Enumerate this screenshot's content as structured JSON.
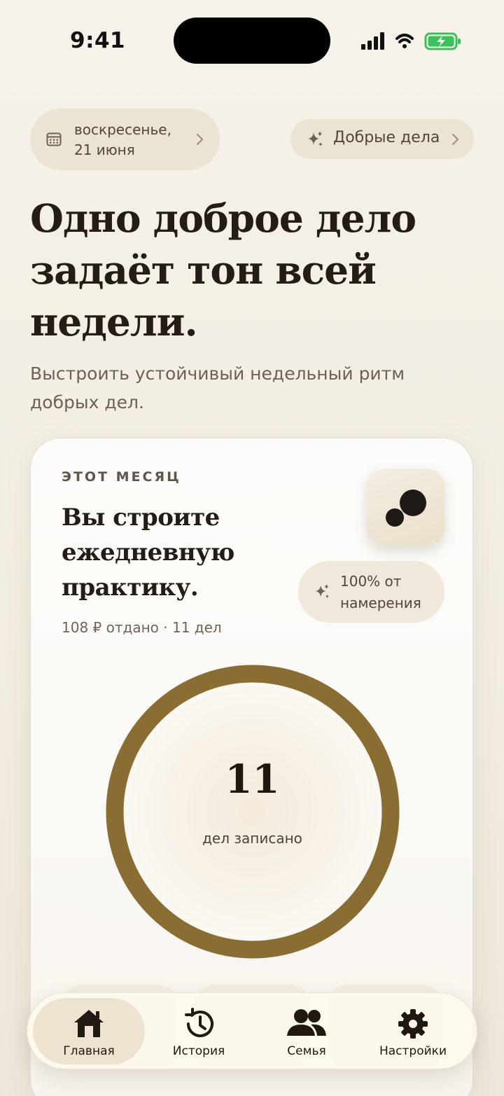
{
  "status_bar": {
    "time": "9:41"
  },
  "date_pill": {
    "line1": "воскресенье,",
    "line2": "21 июня"
  },
  "deeds_pill": {
    "label": "Добрые дела"
  },
  "hero": {
    "title_lines": [
      "Одно доброе дело",
      "задаёт тон всей",
      "недели."
    ],
    "subtitle_lines": [
      "Выстроить устойчивый недельный ритм",
      "добрых дел."
    ]
  },
  "month_card": {
    "eyebrow": "ЭТОТ МЕСЯЦ",
    "title_lines": [
      "Вы строите",
      "ежедневную",
      "практику."
    ],
    "meta": "108 ₽ отдано · 11 дел",
    "intent_lines": [
      "100% от",
      "намерения"
    ],
    "count": "11",
    "count_caption": "дел записано",
    "progress_fraction": 1.0
  },
  "tabbar": {
    "tabs": [
      {
        "label": "Главная",
        "icon": "home-icon",
        "active": true
      },
      {
        "label": "История",
        "icon": "history-icon",
        "active": false
      },
      {
        "label": "Семья",
        "icon": "family-icon",
        "active": false
      },
      {
        "label": "Настройки",
        "icon": "gear-icon",
        "active": false
      }
    ]
  },
  "colors": {
    "accent_ring": "#8a6d33",
    "pill_bg": "#ece4d3",
    "text_primary": "#241d15"
  }
}
